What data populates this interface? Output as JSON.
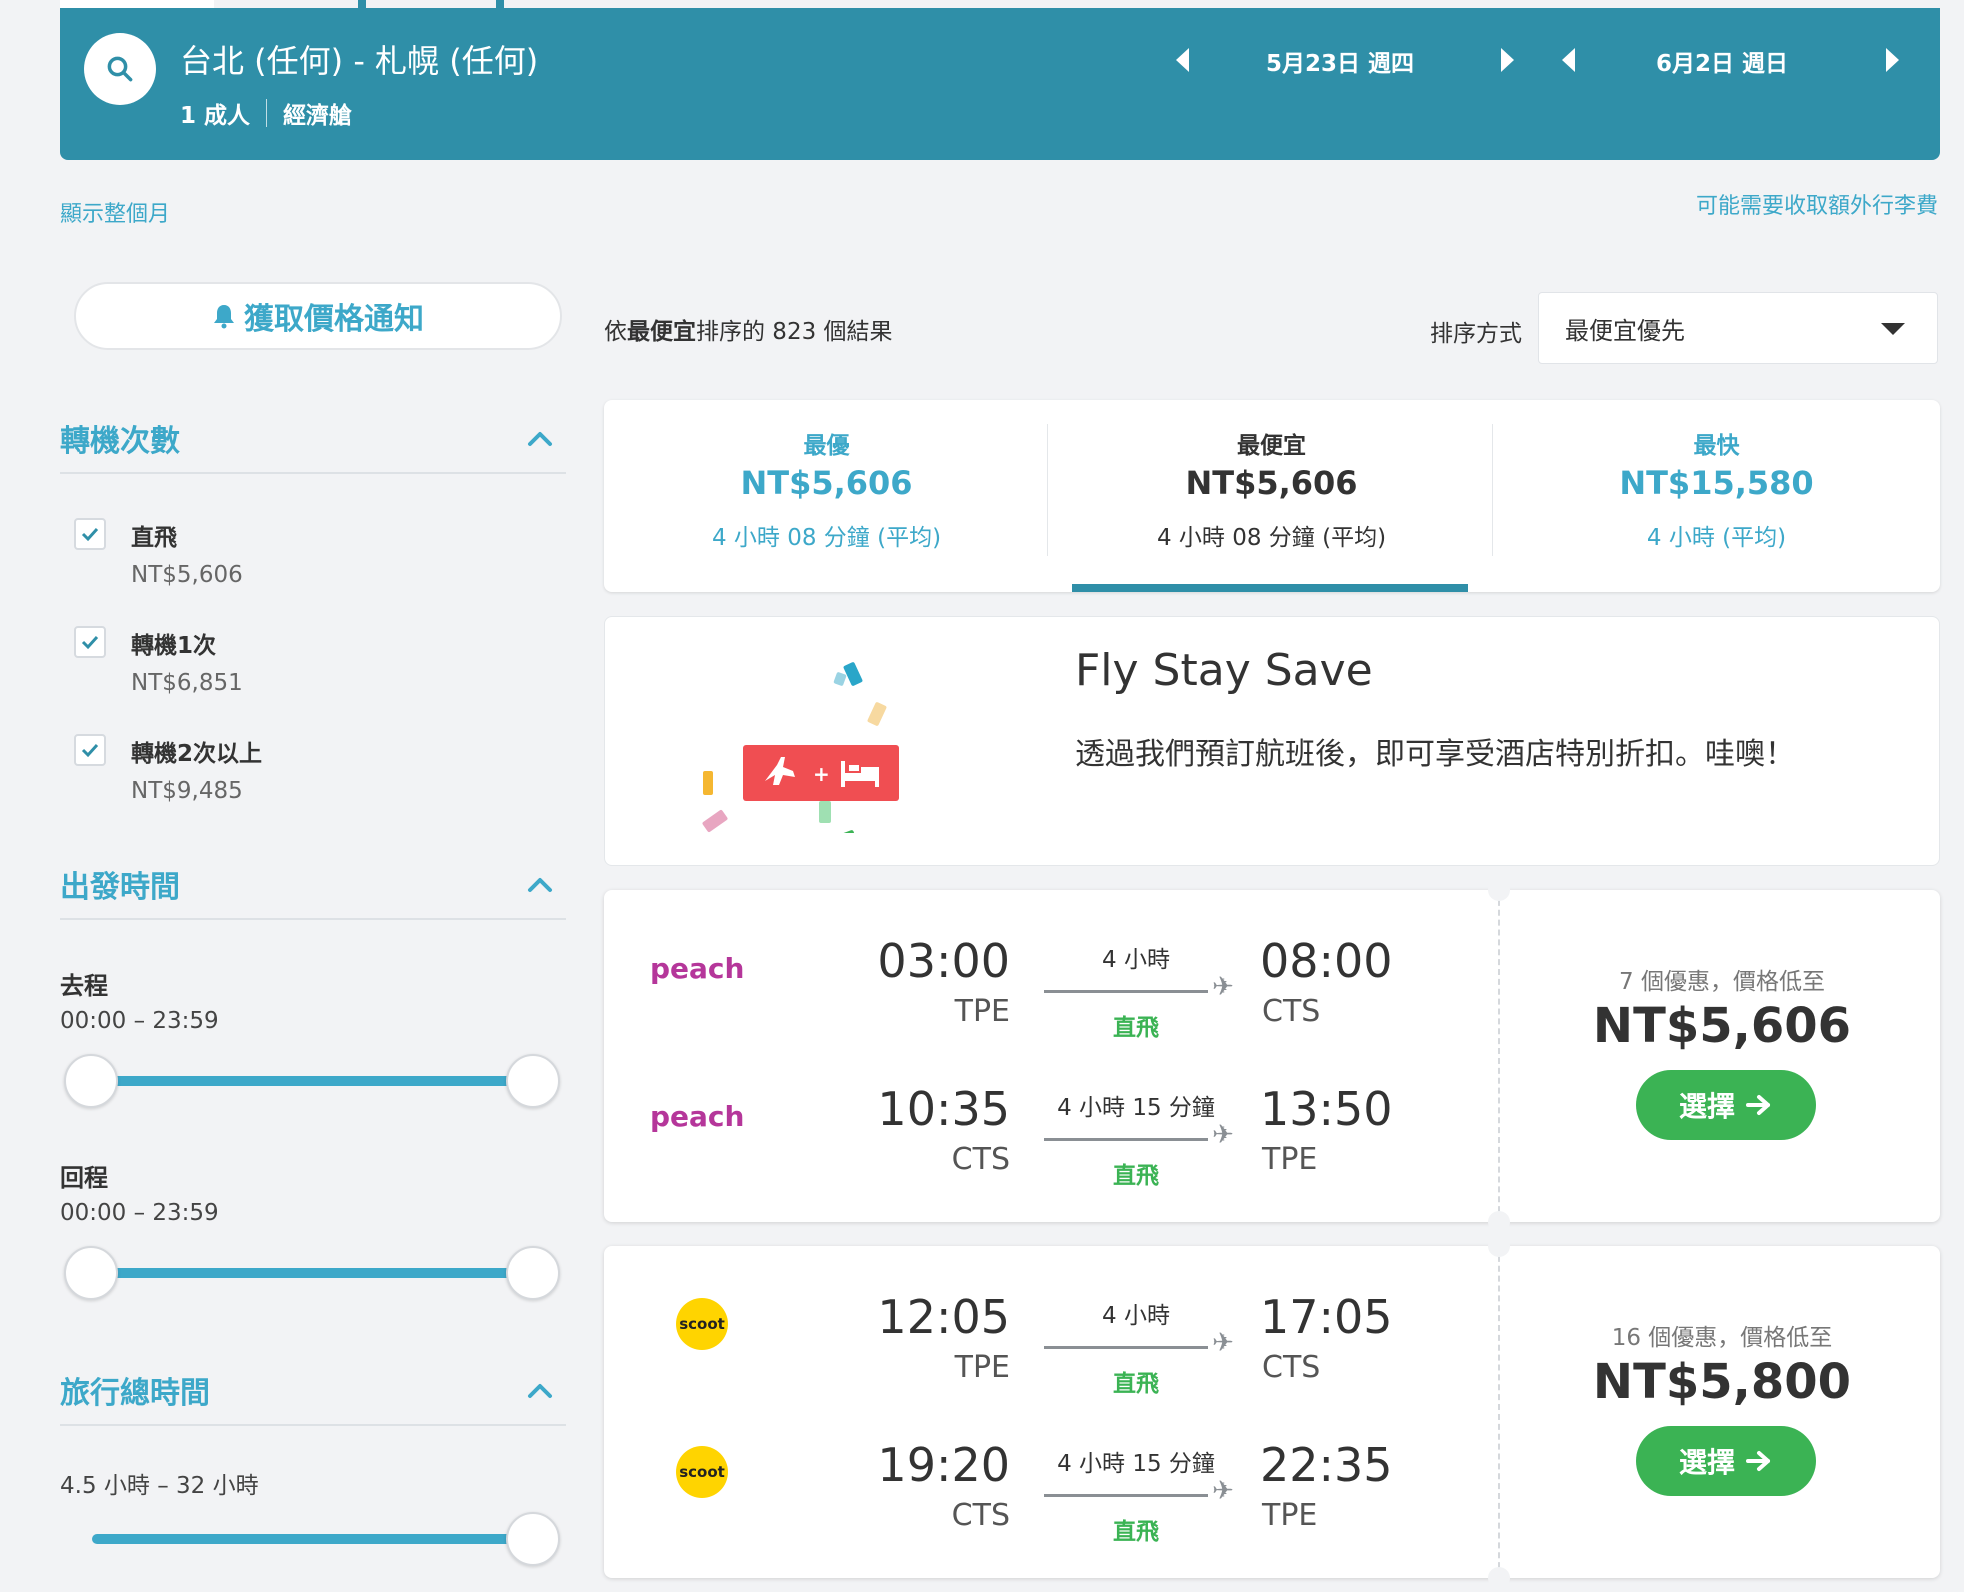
{
  "header": {
    "route": "台北 (任何) - 札幌 (任何)",
    "passengers": "1 成人",
    "cabin": "經濟艙",
    "depart_date": "5月23日 週四",
    "return_date": "6月2日 週日"
  },
  "links": {
    "show_month": "顯示整個月",
    "baggage_fee": "可能需要收取額外行李費"
  },
  "alert_button": "獲取價格通知",
  "filters": {
    "stops": {
      "title": "轉機次數",
      "options": [
        {
          "label": "直飛",
          "price": "NT$5,606",
          "checked": true
        },
        {
          "label": "轉機1次",
          "price": "NT$6,851",
          "checked": true
        },
        {
          "label": "轉機2次以上",
          "price": "NT$9,485",
          "checked": true
        }
      ]
    },
    "departure": {
      "title": "出發時間",
      "outbound_label": "去程",
      "outbound_range": "00:00 – 23:59",
      "return_label": "回程",
      "return_range": "00:00 – 23:59"
    },
    "duration": {
      "title": "旅行總時間",
      "range": "4.5 小時 – 32 小時"
    }
  },
  "results": {
    "prefix": "依",
    "sort_bold": "最便宜",
    "suffix": "排序的 823 個結果",
    "sort_label": "排序方式",
    "sort_value": "最便宜優先"
  },
  "tabs": [
    {
      "label": "最優",
      "price": "NT$5,606",
      "duration": "4 小時 08 分鐘 (平均)"
    },
    {
      "label": "最便宜",
      "price": "NT$5,606",
      "duration": "4 小時 08 分鐘 (平均)"
    },
    {
      "label": "最快",
      "price": "NT$15,580",
      "duration": "4 小時 (平均)"
    }
  ],
  "promo": {
    "title": "Fly Stay Save",
    "text": "透過我們預訂航班後，即可享受酒店特別折扣。哇噢！"
  },
  "flights": [
    {
      "airline": "peach",
      "legs": [
        {
          "dep_time": "03:00",
          "dep_code": "TPE",
          "duration": "4 小時",
          "stops": "直飛",
          "arr_time": "08:00",
          "arr_code": "CTS"
        },
        {
          "dep_time": "10:35",
          "dep_code": "CTS",
          "duration": "4 小時 15 分鐘",
          "stops": "直飛",
          "arr_time": "13:50",
          "arr_code": "TPE"
        }
      ],
      "deals": "7 個優惠，價格低至",
      "price": "NT$5,606",
      "select": "選擇"
    },
    {
      "airline": "scoot",
      "legs": [
        {
          "dep_time": "12:05",
          "dep_code": "TPE",
          "duration": "4 小時",
          "stops": "直飛",
          "arr_time": "17:05",
          "arr_code": "CTS"
        },
        {
          "dep_time": "19:20",
          "dep_code": "CTS",
          "duration": "4 小時 15 分鐘",
          "stops": "直飛",
          "arr_time": "22:35",
          "arr_code": "TPE"
        }
      ],
      "deals": "16 個優惠，價格低至",
      "price": "NT$5,800",
      "select": "選擇"
    }
  ],
  "colors": {
    "header": "#2f8fa8",
    "accent": "#3da8c9",
    "green": "#3bb354",
    "background": "#f2f3f5"
  }
}
